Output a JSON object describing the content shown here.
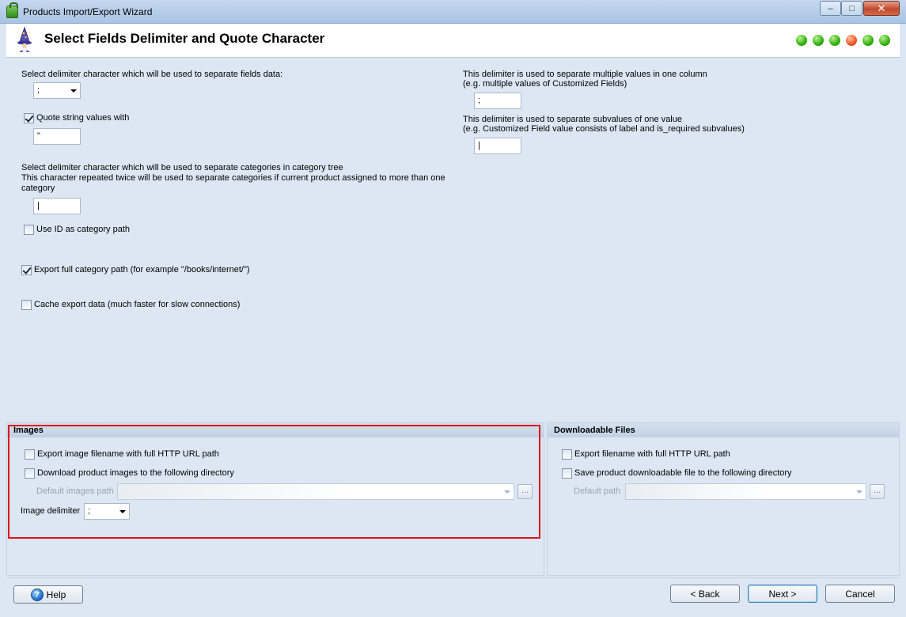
{
  "window": {
    "title": "Products Import/Export Wizard",
    "minimize_label": "–",
    "maximize_label": "□",
    "close_label": "✕"
  },
  "header": {
    "title": "Select Fields Delimiter and Quote Character",
    "progress": {
      "total_steps": 6,
      "current_step": 4
    }
  },
  "main": {
    "field_delimiter": {
      "label": "Select delimiter character which will be used to separate fields data:",
      "value": ";"
    },
    "quote": {
      "checkbox_label": "Quote string values with",
      "checked": true,
      "value": "\""
    },
    "category_delimiter": {
      "label_line1": "Select delimiter character which will be used to separate categories in category tree",
      "label_line2": "This character repeated twice will be used to separate categories if current product assigned to more than one",
      "label_line3": "category",
      "value": "|"
    },
    "use_id_category_path": {
      "label": "Use ID as category path",
      "checked": false
    },
    "export_full_category_path": {
      "label": "Export full category path (for example \"/books/internet/\")",
      "checked": true
    },
    "cache_export_data": {
      "label": "Cache export data (much faster for slow connections)",
      "checked": false
    },
    "multi_value_delimiter": {
      "label_line1": "This delimiter is used to separate multiple values in one column",
      "label_line2": "(e.g. multiple values of Customized Fields)",
      "value": ";"
    },
    "subvalue_delimiter": {
      "label_line1": "This delimiter is used to separate subvalues of one value",
      "label_line2": "(e.g. Customized Field value consists of label and is_required subvalues)",
      "value": "|"
    }
  },
  "images": {
    "title": "Images",
    "export_full_url": {
      "label": "Export image filename with full HTTP URL path",
      "checked": false
    },
    "download_images": {
      "label": "Download product images to the following directory",
      "checked": false
    },
    "default_path_label": "Default images path",
    "browse_label": "...",
    "image_delimiter_label": "Image delimiter",
    "image_delimiter_value": ";"
  },
  "downloadable": {
    "title": "Downloadable Files",
    "export_full_url": {
      "label": "Export filename with full HTTP URL path",
      "checked": false
    },
    "save_files": {
      "label": "Save product downloadable file to the following directory",
      "checked": false
    },
    "default_path_label": "Default path",
    "browse_label": "..."
  },
  "footer": {
    "help_label": "Help",
    "back_label": "< Back",
    "next_label": "Next >",
    "cancel_label": "Cancel"
  }
}
